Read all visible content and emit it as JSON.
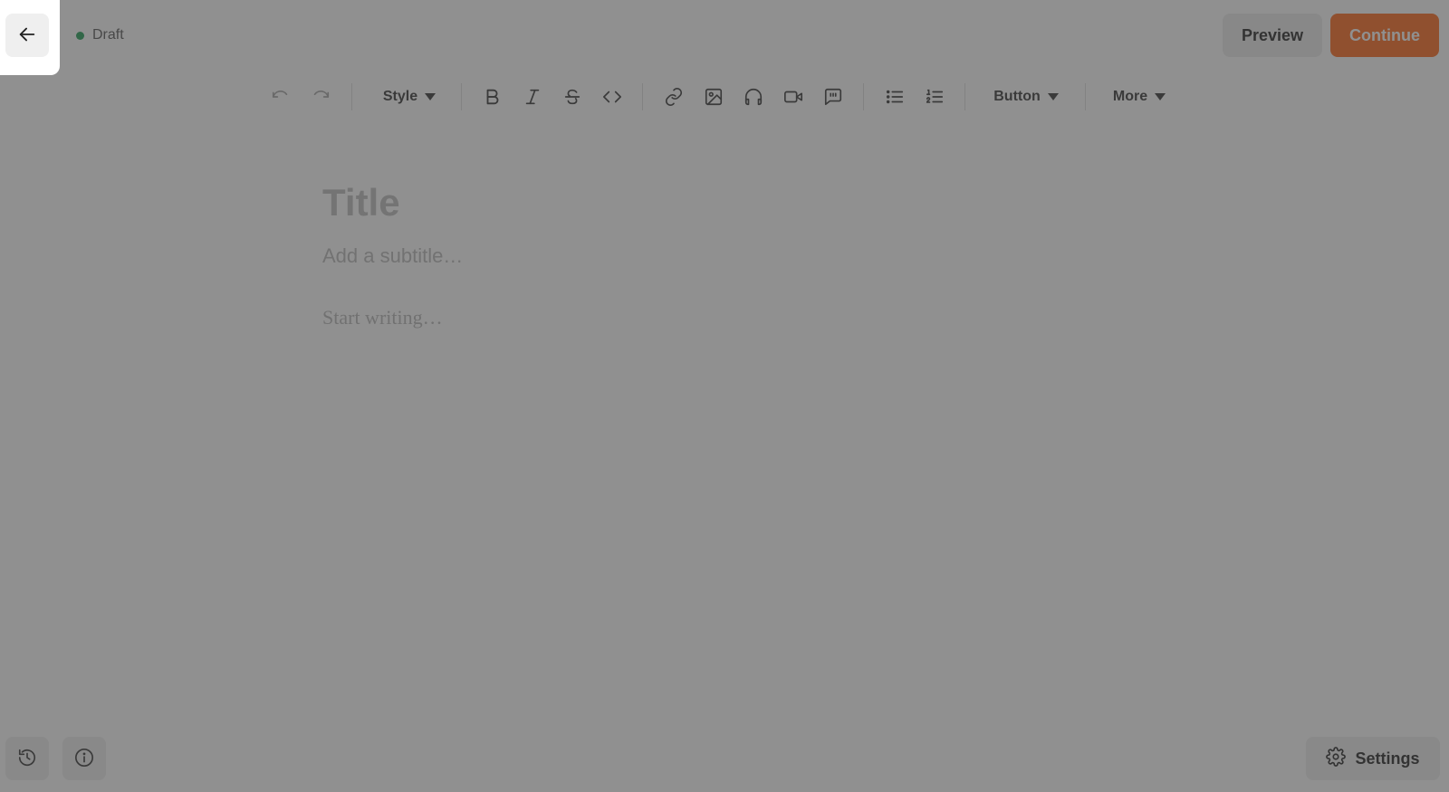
{
  "header": {
    "status_label": "Draft",
    "status_color": "#1f9d55",
    "preview_label": "Preview",
    "continue_label": "Continue",
    "accent_color": "#ff6719"
  },
  "toolbar": {
    "style_label": "Style",
    "button_label": "Button",
    "more_label": "More",
    "icons": [
      "undo-icon",
      "redo-icon",
      "bold-icon",
      "italic-icon",
      "strikethrough-icon",
      "code-icon",
      "link-icon",
      "image-icon",
      "audio-icon",
      "video-icon",
      "quote-icon",
      "bullet-list-icon",
      "numbered-list-icon"
    ]
  },
  "editor": {
    "title_placeholder": "Title",
    "subtitle_placeholder": "Add a subtitle…",
    "body_placeholder": "Start writing…"
  },
  "footer": {
    "settings_label": "Settings",
    "icons": [
      "history-icon",
      "info-icon",
      "gear-icon"
    ]
  },
  "overlay": {
    "highlighted_element": "back-button"
  }
}
